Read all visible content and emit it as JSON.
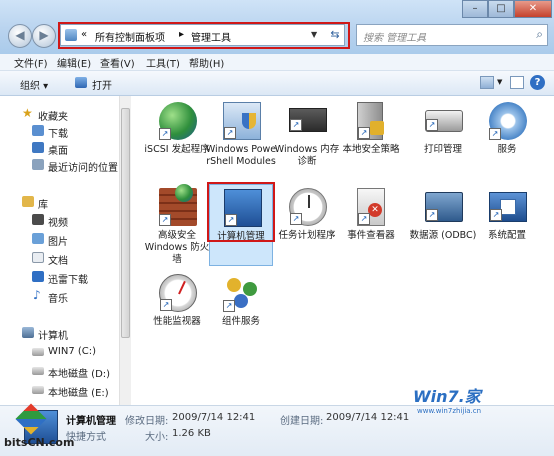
{
  "address": {
    "prefix": "«",
    "crumb_1": "所有控制面板项",
    "sep": "▸",
    "crumb_2": "管理工具"
  },
  "search": {
    "placeholder": "搜索 管理工具"
  },
  "window_controls": {
    "minimize": "–",
    "maximize": "□",
    "close": "✕"
  },
  "menu": [
    "文件(F)",
    "编辑(E)",
    "查看(V)",
    "工具(T)",
    "帮助(H)"
  ],
  "toolbar": {
    "organize": "组织 ▾",
    "open": "打开"
  },
  "sidebar": {
    "favorites": "收藏夹",
    "downloads": "下载",
    "desktop": "桌面",
    "recent": "最近访问的位置",
    "libraries": "库",
    "videos": "视频",
    "pictures": "图片",
    "documents": "文档",
    "thunder": "迅雷下载",
    "music": "音乐",
    "computer": "计算机",
    "drive_c": "WIN7 (C:)",
    "drive_d": "本地磁盘 (D:)",
    "drive_e": "本地磁盘 (E:)"
  },
  "items": [
    {
      "label": "iSCSI 发起程序"
    },
    {
      "label": "Windows PowerShell Modules"
    },
    {
      "label": "Windows 内存诊断"
    },
    {
      "label": "本地安全策略"
    },
    {
      "label": "打印管理"
    },
    {
      "label": "服务"
    },
    {
      "label": "高级安全 Windows 防火墙"
    },
    {
      "label": "计算机管理"
    },
    {
      "label": "任务计划程序"
    },
    {
      "label": "事件查看器"
    },
    {
      "label": "数据源 (ODBC)"
    },
    {
      "label": "系统配置"
    },
    {
      "label": "性能监视器"
    },
    {
      "label": "组件服务"
    }
  ],
  "details": {
    "name": "计算机管理",
    "modified_key": "修改日期:",
    "modified_val": "2009/7/14 12:41",
    "created_key": "创建日期:",
    "created_val": "2009/7/14 12:41",
    "type": "快捷方式",
    "size_key": "大小:",
    "size_val": "1.26 KB"
  },
  "watermarks": {
    "left": "bitsCN.com",
    "right": "Win7.家",
    "right_sub": "www.win7zhijia.cn"
  },
  "colors": {
    "highlight_red": "#d01818",
    "selection_blue": "#cde6fb"
  }
}
